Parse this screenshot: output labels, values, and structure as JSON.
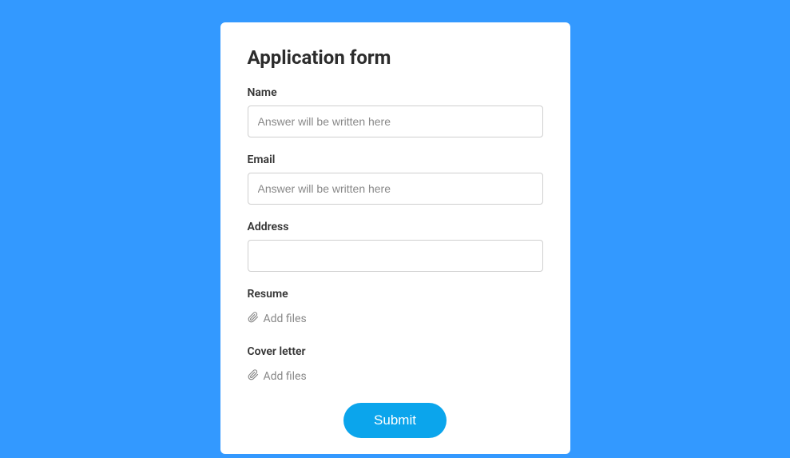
{
  "form": {
    "title": "Application form",
    "fields": {
      "name": {
        "label": "Name",
        "placeholder": "Answer will be written here"
      },
      "email": {
        "label": "Email",
        "placeholder": "Answer will be written here"
      },
      "address": {
        "label": "Address",
        "placeholder": ""
      },
      "resume": {
        "label": "Resume",
        "add_files_text": "Add files"
      },
      "cover_letter": {
        "label": "Cover letter",
        "add_files_text": "Add files"
      }
    },
    "submit_label": "Submit"
  }
}
